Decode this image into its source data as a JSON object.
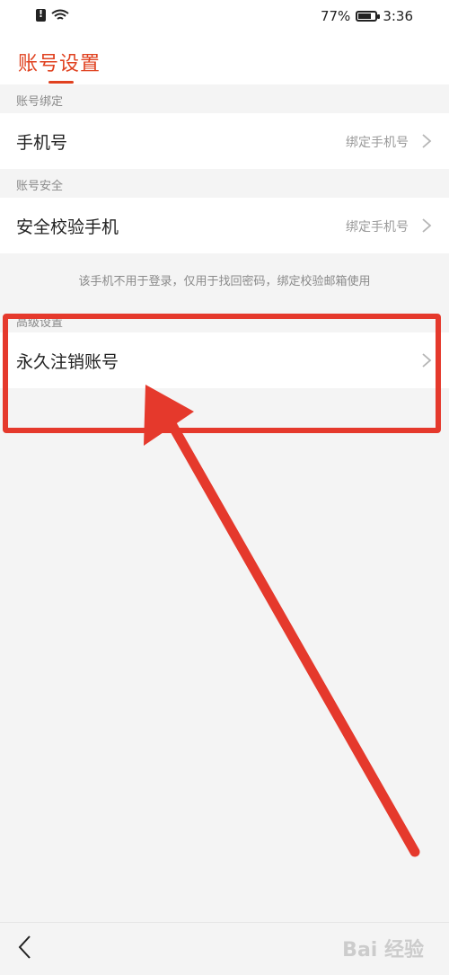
{
  "status_bar": {
    "battery": "77%",
    "battery_level": 0.77,
    "time": "3:36",
    "icons": [
      "sim-alert-icon",
      "wifi-icon",
      "battery-icon"
    ]
  },
  "header": {
    "title": "账号设置",
    "accent_color": "#e0411f"
  },
  "sections": {
    "binding": {
      "header": "账号绑定",
      "row": {
        "label": "手机号",
        "value": "绑定手机号"
      }
    },
    "security": {
      "header": "账号安全",
      "row": {
        "label": "安全校验手机",
        "value": "绑定手机号"
      },
      "hint": "该手机不用于登录，仅用于找回密码，绑定校验邮箱使用"
    },
    "advanced": {
      "header": "高级设置",
      "row": {
        "label": "永久注销账号"
      }
    }
  },
  "annotation": {
    "color": "#e5392c"
  },
  "footer": {
    "back_icon": "back-icon",
    "watermark": "Bai 经验"
  }
}
